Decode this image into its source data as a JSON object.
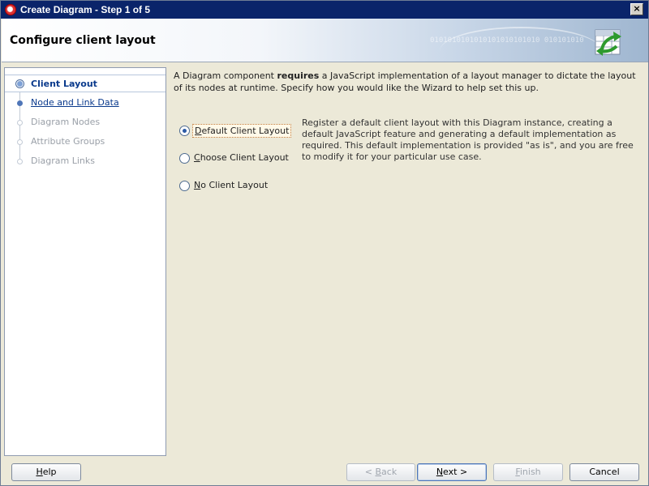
{
  "window": {
    "title": "Create Diagram - Step 1 of 5"
  },
  "header": {
    "page_title": "Configure client layout",
    "binary_text": "0101010101010101010101010 010101010"
  },
  "nav": {
    "steps": [
      {
        "label": "Client Layout",
        "state": "current"
      },
      {
        "label": "Node and Link Data",
        "state": "link"
      },
      {
        "label": "Diagram Nodes",
        "state": "disabled"
      },
      {
        "label": "Attribute Groups",
        "state": "disabled"
      },
      {
        "label": "Diagram Links",
        "state": "disabled"
      }
    ]
  },
  "main": {
    "intro_before": "A Diagram component ",
    "intro_bold": "requires",
    "intro_after": " a JavaScript implementation of a layout manager to dictate the layout of its nodes at runtime. Specify how you would like the Wizard to help set this up.",
    "options": [
      {
        "label": "Default Client Layout",
        "mnemonic": "D",
        "rest": "efault Client Layout",
        "checked": true
      },
      {
        "label": "Choose Client Layout",
        "mnemonic": "C",
        "rest": "hoose Client Layout",
        "checked": false
      },
      {
        "label": "No Client Layout",
        "mnemonic": "N",
        "rest": "o Client Layout",
        "checked": false
      }
    ],
    "description": "Register a default client layout with this Diagram instance, creating a default JavaScript feature and generating a default implementation as required. This default implementation is provided \"as is\", and you are free to modify it for your particular use case."
  },
  "buttons": {
    "help": {
      "label": "Help",
      "mnemonic": "H",
      "rest": "elp"
    },
    "back": {
      "label": "< Back",
      "prefix": "< ",
      "mnemonic": "B",
      "rest": "ack"
    },
    "next": {
      "label": "Next >",
      "mnemonic": "N",
      "rest": "ext >"
    },
    "finish": {
      "label": "Finish",
      "mnemonic": "F",
      "rest": "inish"
    },
    "cancel": {
      "label": "Cancel"
    }
  },
  "icons": {
    "app": "oracle-logo-icon",
    "close": "close-icon",
    "wizard": "wizard-diagram-icon",
    "radio": "radio-button"
  },
  "colors": {
    "title_bar": "#0a246a",
    "link_blue": "#0a3a8c",
    "accent_blue": "#4f76b8"
  }
}
